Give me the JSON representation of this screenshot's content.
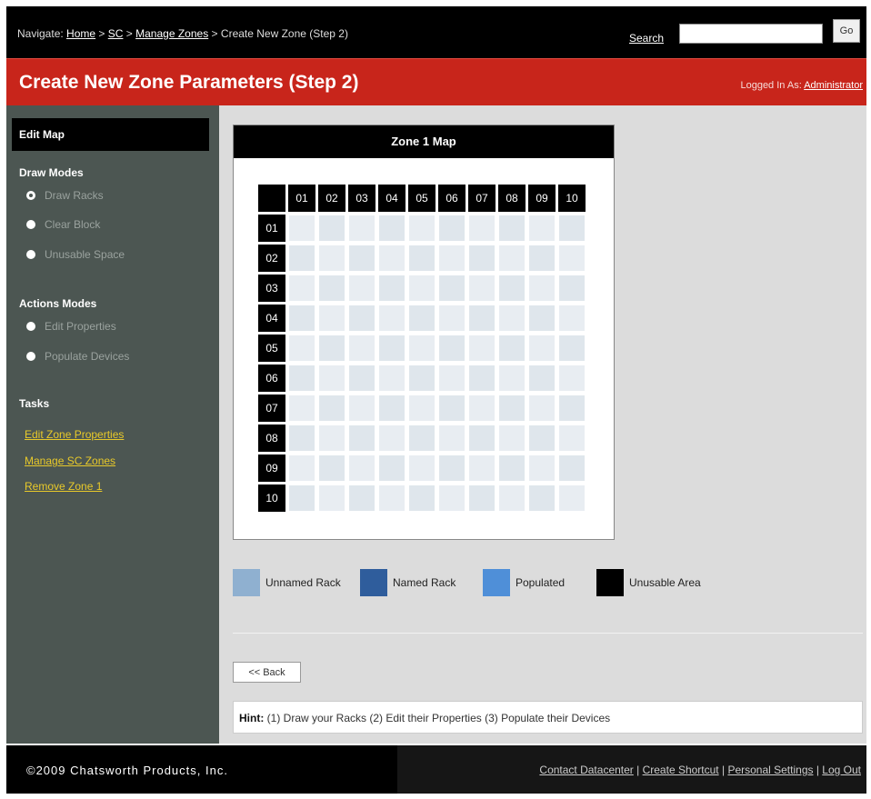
{
  "topbar": {
    "nav_prefix": "Navigate:",
    "breadcrumbs": [
      "Home",
      "SC",
      "Manage Zones"
    ],
    "separator": ">",
    "current": "Create New Zone (Step 2)",
    "search_label": "Search",
    "search_value": "",
    "go_label": "Go"
  },
  "titlebar": {
    "title": "Create New Zone Parameters (Step 2)",
    "logged_in_label": "Logged In As:",
    "user": "Administrator"
  },
  "sidebar": {
    "edit_map": "Edit Map",
    "draw_modes_heading": "Draw Modes",
    "draw_modes": [
      "Draw Racks",
      "Clear Block",
      "Unusable Space"
    ],
    "draw_modes_selected": 0,
    "actions_heading": "Actions Modes",
    "actions": [
      "Edit Properties",
      "Populate Devices"
    ],
    "tasks_heading": "Tasks",
    "tasks": [
      "Edit Zone Properties",
      "Manage SC Zones",
      "Remove Zone 1"
    ]
  },
  "map": {
    "title": "Zone 1 Map",
    "columns": [
      "01",
      "02",
      "03",
      "04",
      "05",
      "06",
      "07",
      "08",
      "09",
      "10"
    ],
    "rows": [
      "01",
      "02",
      "03",
      "04",
      "05",
      "06",
      "07",
      "08",
      "09",
      "10"
    ]
  },
  "legend": [
    {
      "label": "Unnamed Rack",
      "color": "#8fb0d0"
    },
    {
      "label": "Named Rack",
      "color": "#2f5d9c"
    },
    {
      "label": "Populated",
      "color": "#4f8fd8"
    },
    {
      "label": "Unusable Area",
      "color": "#000000"
    }
  ],
  "back_label": "<< Back",
  "hint": {
    "label": "Hint:",
    "text": "(1) Draw your Racks (2) Edit their Properties (3) Populate their Devices"
  },
  "footer": {
    "copyright": "©2009 Chatsworth Products, Inc.",
    "links": [
      "Contact Datacenter",
      "Create Shortcut",
      "Personal Settings",
      "Log Out"
    ]
  },
  "colors": {
    "header_black": "#000000",
    "title_red": "#c8251b",
    "sidebar_gray": "#4c5652",
    "task_link_yellow": "#e8c92a",
    "main_bg": "#dcdcdc"
  }
}
